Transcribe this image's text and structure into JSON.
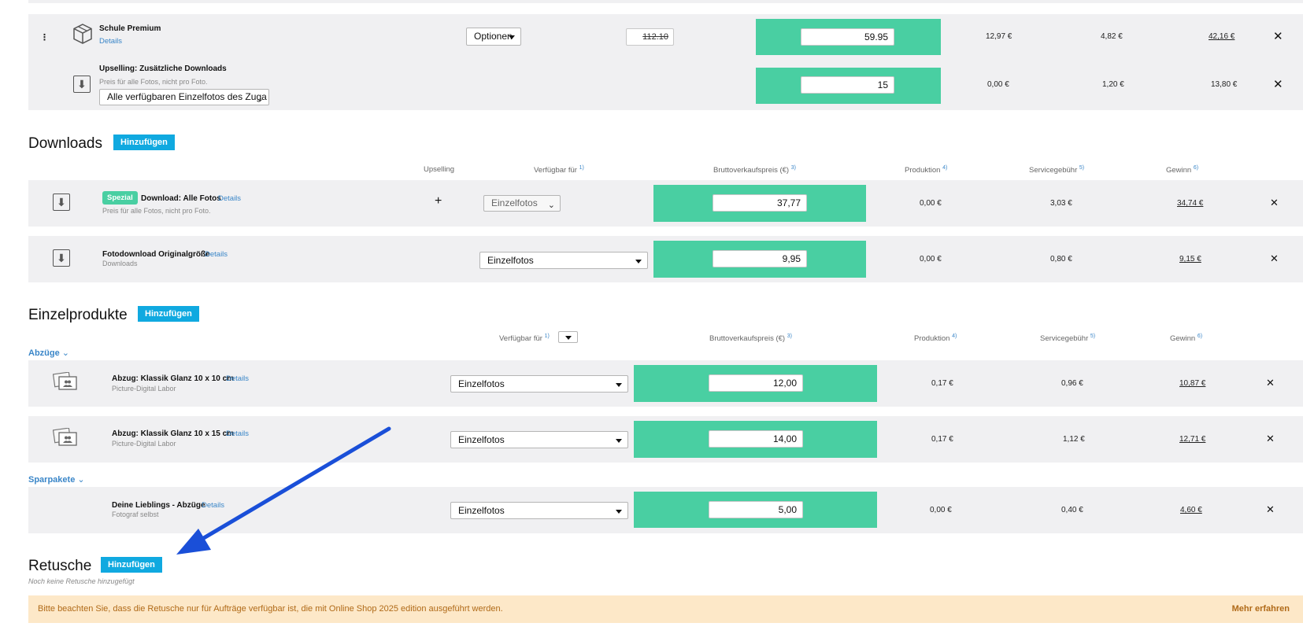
{
  "top_rows": [
    {
      "title": "Schule Premium",
      "details_label": "Details",
      "options_label": "Optionen",
      "old_price": "112.10",
      "price": "59.95",
      "production": "12,97 €",
      "service_fee": "4,82 €",
      "profit": "42,16 €"
    },
    {
      "title": "Upselling: Zusätzliche Downloads",
      "subtitle": "Preis für alle Fotos, nicht pro Foto.",
      "select_value": "Alle verfügbaren Einzelfotos des Zuga",
      "price": "15",
      "production": "0,00 €",
      "service_fee": "1,20 €",
      "profit": "13,80 €"
    }
  ],
  "downloads": {
    "title": "Downloads",
    "add_label": "Hinzufügen",
    "headers": {
      "upselling": "Upselling",
      "available_for": "Verfügbar für",
      "available_for_note": "1)",
      "gross_price": "Bruttoverkaufspreis (€)",
      "gross_price_note": "3)",
      "production": "Produktion",
      "production_note": "4)",
      "service_fee": "Servicegebühr",
      "service_fee_note": "5)",
      "profit": "Gewinn",
      "profit_note": "6)"
    },
    "items": [
      {
        "badge": "Spezial",
        "title": "Download: Alle Fotos",
        "details_label": "Details",
        "subtitle": "Preis für alle Fotos, nicht pro Foto.",
        "upselling_symbol": "+",
        "available_for": "Einzelfotos",
        "price": "37,77",
        "production": "0,00 €",
        "service_fee": "3,03 €",
        "profit": "34,74 €"
      },
      {
        "title": "Fotodownload Originalgröße",
        "details_label": "Details",
        "subtitle": "Downloads",
        "available_for": "Einzelfotos",
        "price": "9,95",
        "production": "0,00 €",
        "service_fee": "0,80 €",
        "profit": "9,15 €"
      }
    ]
  },
  "einzelprodukte": {
    "title": "Einzelprodukte",
    "add_label": "Hinzufügen",
    "headers": {
      "available_for": "Verfügbar für",
      "available_for_note": "1)",
      "gross_price": "Bruttoverkaufspreis (€)",
      "gross_price_note": "3)",
      "production": "Produktion",
      "production_note": "4)",
      "service_fee": "Servicegebühr",
      "service_fee_note": "5)",
      "profit": "Gewinn",
      "profit_note": "6)"
    },
    "groups": [
      {
        "label": "Abzüge",
        "items": [
          {
            "title": "Abzug: Klassik Glanz 10 x 10 cm",
            "details_label": "Details",
            "subtitle": "Picture-Digital Labor",
            "available_for": "Einzelfotos",
            "price": "12,00",
            "production": "0,17 €",
            "service_fee": "0,96 €",
            "profit": "10,87 €"
          },
          {
            "title": "Abzug: Klassik Glanz 10 x 15 cm",
            "details_label": "Details",
            "subtitle": "Picture-Digital Labor",
            "available_for": "Einzelfotos",
            "price": "14,00",
            "production": "0,17 €",
            "service_fee": "1,12 €",
            "profit": "12,71 €"
          }
        ]
      },
      {
        "label": "Sparpakete",
        "items": [
          {
            "title": "Deine Lieblings - Abzüge",
            "details_label": "Details",
            "subtitle": "Fotograf selbst",
            "available_for": "Einzelfotos",
            "price": "5,00",
            "production": "0,00 €",
            "service_fee": "0,40 €",
            "profit": "4,60 €"
          }
        ]
      }
    ]
  },
  "retusche": {
    "title": "Retusche",
    "add_label": "Hinzufügen",
    "empty_text": "Noch keine Retusche hinzugefügt"
  },
  "notice": {
    "text": "Bitte beachten Sie, dass die Retusche nur für Aufträge verfügbar ist, die mit Online Shop 2025 edition ausgeführt werden.",
    "link_label": "Mehr erfahren"
  },
  "icons": {
    "drag": "drag-handle-icon",
    "package": "package-box-icon",
    "download": "download-icon",
    "photo_print": "photo-print-icon",
    "remove": "close-icon",
    "annotation": "arrow-annotation"
  },
  "colors": {
    "price_green": "#49cfa2",
    "button_blue": "#10a9e0",
    "link_blue": "#3a86c8",
    "row_gray": "#f0f0f2",
    "notice_bg": "#fde8c8",
    "notice_text": "#b06a18",
    "arrow": "#1a4fd8"
  }
}
